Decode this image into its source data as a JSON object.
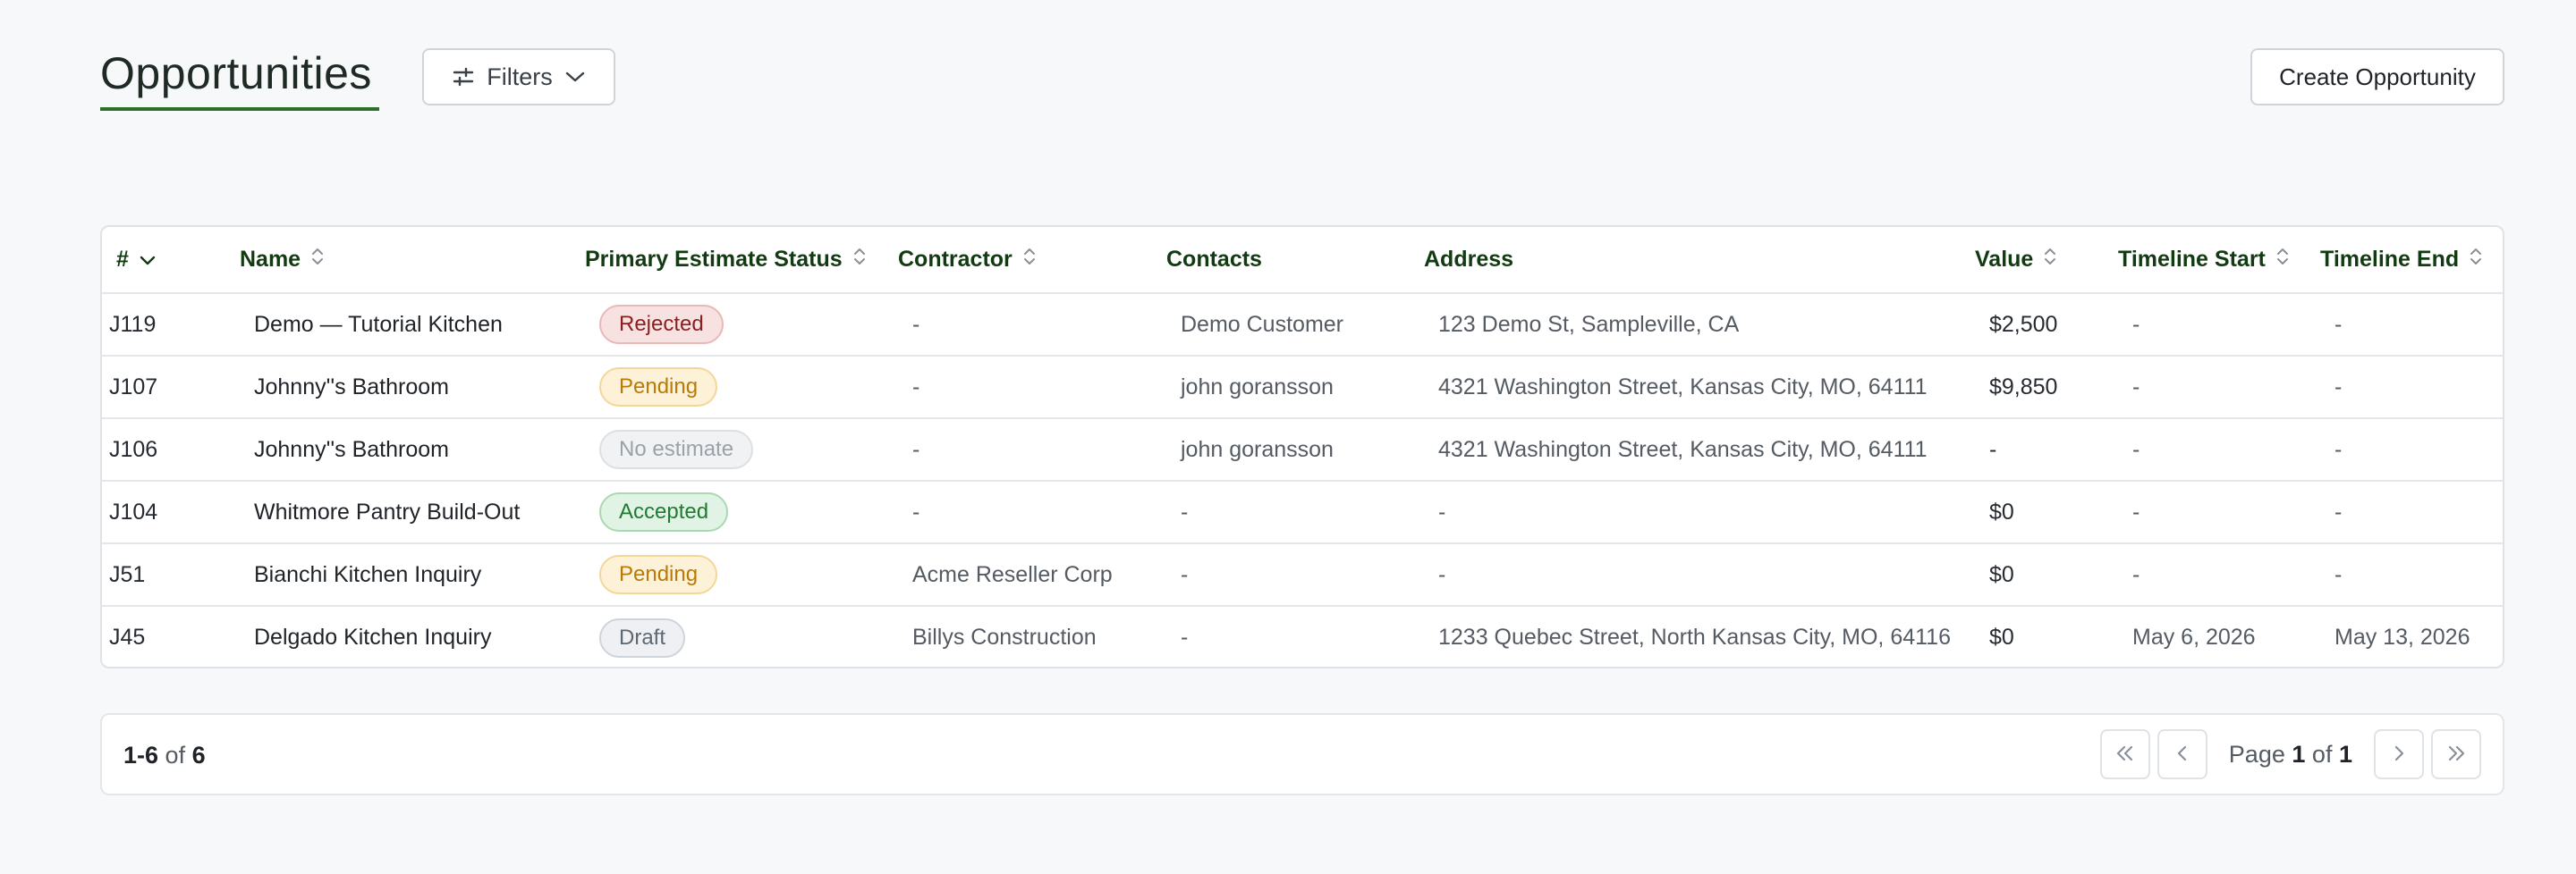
{
  "header": {
    "title": "Opportunities",
    "filters_label": "Filters",
    "create_label": "Create Opportunity"
  },
  "table": {
    "columns": {
      "num": "#",
      "name": "Name",
      "status": "Primary Estimate Status",
      "contractor": "Contractor",
      "contacts": "Contacts",
      "address": "Address",
      "value": "Value",
      "timeline_start": "Timeline Start",
      "timeline_end": "Timeline End"
    },
    "rows": [
      {
        "num": "J119",
        "name": "Demo — Tutorial Kitchen",
        "status": "Rejected",
        "contractor": "-",
        "contacts": "Demo Customer",
        "address": "123 Demo St, Sampleville, CA",
        "value": "$2,500",
        "start": "-",
        "end": "-"
      },
      {
        "num": "J107",
        "name": "Johnny''s Bathroom",
        "status": "Pending",
        "contractor": "-",
        "contacts": "john goransson",
        "address": "4321 Washington Street, Kansas City, MO, 64111",
        "value": "$9,850",
        "start": "-",
        "end": "-"
      },
      {
        "num": "J106",
        "name": "Johnny''s Bathroom",
        "status": "No estimate",
        "contractor": "-",
        "contacts": "john goransson",
        "address": "4321 Washington Street, Kansas City, MO, 64111",
        "value": "-",
        "start": "-",
        "end": "-"
      },
      {
        "num": "J104",
        "name": "Whitmore Pantry Build-Out",
        "status": "Accepted",
        "contractor": "-",
        "contacts": "-",
        "address": "-",
        "value": "$0",
        "start": "-",
        "end": "-"
      },
      {
        "num": "J51",
        "name": "Bianchi Kitchen Inquiry",
        "status": "Pending",
        "contractor": "Acme Reseller Corp",
        "contacts": "-",
        "address": "-",
        "value": "$0",
        "start": "-",
        "end": "-"
      },
      {
        "num": "J45",
        "name": "Delgado Kitchen Inquiry",
        "status": "Draft",
        "contractor": "Billys Construction",
        "contacts": "-",
        "address": "1233 Quebec Street, North Kansas City, MO, 64116",
        "value": "$0",
        "start": "May 6, 2026",
        "end": "May 13, 2026"
      }
    ]
  },
  "footer": {
    "range": "1-6",
    "of_word": "of",
    "total": "6",
    "page_word": "Page",
    "current_page": "1",
    "page_of_word": "of",
    "total_pages": "1"
  },
  "icons": {
    "filters": "sliders-icon",
    "dropdown": "chevron-down-icon",
    "sort": "sort-icon",
    "sort_desc": "chevron-down-icon",
    "first": "chevrons-left-icon",
    "prev": "chevron-left-icon",
    "next": "chevron-right-icon",
    "last": "chevrons-right-icon"
  },
  "colors": {
    "accent": "#2d6e2d",
    "header_text": "#123b12",
    "rejected": "#8a1f1f",
    "pending": "#b97a06",
    "accepted": "#1f7a33",
    "draft": "#5e6872",
    "no_estimate": "#9aa1a9"
  }
}
